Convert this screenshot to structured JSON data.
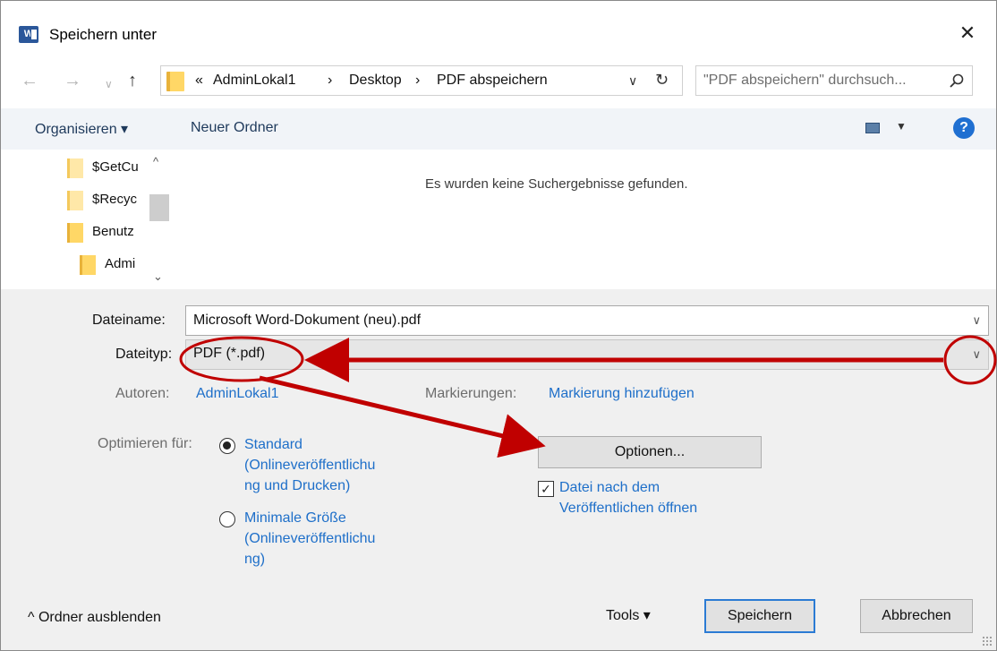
{
  "window": {
    "title": "Speichern unter",
    "app_icon_letter": "W",
    "close_glyph": "✕"
  },
  "nav": {
    "back_glyph": "←",
    "forward_glyph": "→",
    "recent_glyph": "∨",
    "up_glyph": "↑",
    "breadcrumb": [
      "«",
      "AdminLokal1",
      "›",
      "Desktop",
      "›",
      "PDF abspeichern"
    ],
    "dropdown_glyph": "∨",
    "refresh_glyph": "↻",
    "search_placeholder": "\"PDF abspeichern\" durchsuch..."
  },
  "toolbar": {
    "organize_label": "Organisieren ▾",
    "new_folder_label": "Neuer Ordner",
    "view_dropdown_glyph": "▼",
    "help_glyph": "?"
  },
  "tree": {
    "items": [
      {
        "label": "$GetCu",
        "indent": 0,
        "faded": true
      },
      {
        "label": "$Recyc",
        "indent": 0,
        "faded": true
      },
      {
        "label": "Benutz",
        "indent": 0,
        "faded": false
      },
      {
        "label": "Admi",
        "indent": 1,
        "faded": false
      }
    ],
    "scroll_up_glyph": "^",
    "scroll_down_glyph": "⌄"
  },
  "content": {
    "no_results": "Es wurden keine Suchergebnisse gefunden."
  },
  "details": {
    "filename_label": "Dateiname:",
    "filename_value": "Microsoft Word-Dokument (neu).pdf",
    "filetype_label": "Dateityp:",
    "filetype_value": "PDF (*.pdf)",
    "combo_glyph": "∨",
    "authors_label": "Autoren:",
    "authors_value": "AdminLokal1",
    "tags_label": "Markierungen:",
    "tags_value": "Markierung hinzufügen",
    "optimize_label": "Optimieren für:",
    "optimize_standard": [
      "Standard",
      "(Onlineveröffentlichu",
      "ng und Drucken)"
    ],
    "optimize_minimal": [
      "Minimale Größe",
      "(Onlineveröffentlichu",
      "ng)"
    ],
    "options_button": "Optionen...",
    "open_after_publish": [
      "Datei nach dem",
      "Veröffentlichen öffnen"
    ],
    "open_after_publish_checked": true,
    "checkmark_glyph": "✓",
    "optimize_selected": "standard"
  },
  "footer": {
    "hide_folders": "^  Ordner ausblenden",
    "tools_label": "Tools   ▾",
    "save_button": "Speichern",
    "cancel_button": "Abbrechen"
  },
  "colors": {
    "link_blue": "#1e6fc9",
    "annotation_red": "#c00000",
    "toolbar_bg": "#f1f4f8",
    "details_bg": "#f0f0f0",
    "help_blue": "#1f6fd1"
  }
}
